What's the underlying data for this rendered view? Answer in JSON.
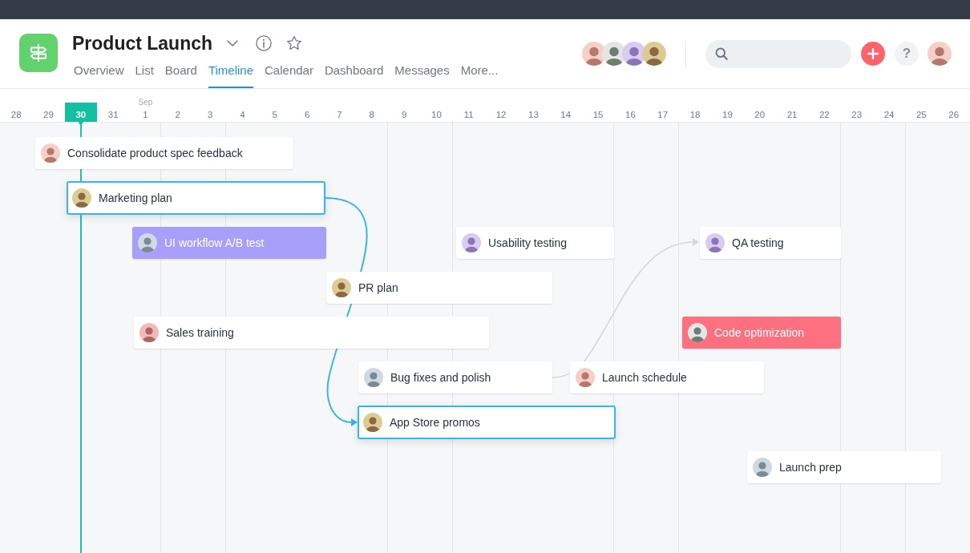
{
  "project": {
    "title": "Product Launch"
  },
  "tabs": [
    {
      "label": "Overview",
      "selected": false
    },
    {
      "label": "List",
      "selected": false
    },
    {
      "label": "Board",
      "selected": false
    },
    {
      "label": "Timeline",
      "selected": true
    },
    {
      "label": "Calendar",
      "selected": false
    },
    {
      "label": "Dashboard",
      "selected": false
    },
    {
      "label": "Messages",
      "selected": false
    },
    {
      "label": "More...",
      "selected": false
    }
  ],
  "help_button": {
    "label": "?"
  },
  "days": [
    {
      "label": "28",
      "today": false,
      "weekend": false
    },
    {
      "label": "29",
      "today": false,
      "weekend": false
    },
    {
      "label": "30",
      "today": true,
      "weekend": false
    },
    {
      "label": "31",
      "today": false,
      "weekend": false
    },
    {
      "label": "1",
      "month": "Sep",
      "today": false,
      "weekend": false
    },
    {
      "label": "2",
      "today": false,
      "weekend": true
    },
    {
      "label": "3",
      "today": false,
      "weekend": true
    },
    {
      "label": "4",
      "today": false,
      "weekend": false
    },
    {
      "label": "5",
      "today": false,
      "weekend": false
    },
    {
      "label": "6",
      "today": false,
      "weekend": false
    },
    {
      "label": "7",
      "today": false,
      "weekend": false
    },
    {
      "label": "8",
      "today": false,
      "weekend": false
    },
    {
      "label": "9",
      "today": false,
      "weekend": true
    },
    {
      "label": "10",
      "today": false,
      "weekend": true
    },
    {
      "label": "11",
      "today": false,
      "weekend": false
    },
    {
      "label": "12",
      "today": false,
      "weekend": false
    },
    {
      "label": "13",
      "today": false,
      "weekend": false
    },
    {
      "label": "14",
      "today": false,
      "weekend": false
    },
    {
      "label": "15",
      "today": false,
      "weekend": false
    },
    {
      "label": "16",
      "today": false,
      "weekend": true
    },
    {
      "label": "17",
      "today": false,
      "weekend": true
    },
    {
      "label": "18",
      "today": false,
      "weekend": false
    },
    {
      "label": "19",
      "today": false,
      "weekend": false
    },
    {
      "label": "20",
      "today": false,
      "weekend": false
    },
    {
      "label": "21",
      "today": false,
      "weekend": false
    },
    {
      "label": "22",
      "today": false,
      "weekend": false
    },
    {
      "label": "23",
      "today": false,
      "weekend": true
    },
    {
      "label": "24",
      "today": false,
      "weekend": true
    },
    {
      "label": "25",
      "today": false,
      "weekend": false
    },
    {
      "label": "26",
      "today": false,
      "weekend": false
    }
  ],
  "tasks": [
    {
      "title": "Consolidate product spec feedback",
      "color": "#ffffff",
      "selected": false
    },
    {
      "title": "Marketing plan",
      "color": "#ffffff",
      "selected": true
    },
    {
      "title": "UI workflow A/B test",
      "color": "#a79ff9",
      "selected": false
    },
    {
      "title": "Usability testing",
      "color": "#ffffff",
      "selected": false
    },
    {
      "title": "QA testing",
      "color": "#ffffff",
      "selected": false
    },
    {
      "title": "PR plan",
      "color": "#ffffff",
      "selected": false
    },
    {
      "title": "Sales training",
      "color": "#ffffff",
      "selected": false
    },
    {
      "title": "Code optimization",
      "color": "#fc7080",
      "selected": false
    },
    {
      "title": "Bug fixes and polish",
      "color": "#ffffff",
      "selected": false
    },
    {
      "title": "Launch schedule",
      "color": "#ffffff",
      "selected": false
    },
    {
      "title": "App Store promos",
      "color": "#ffffff",
      "selected": true
    },
    {
      "title": "Launch prep",
      "color": "#ffffff",
      "selected": false
    }
  ]
}
